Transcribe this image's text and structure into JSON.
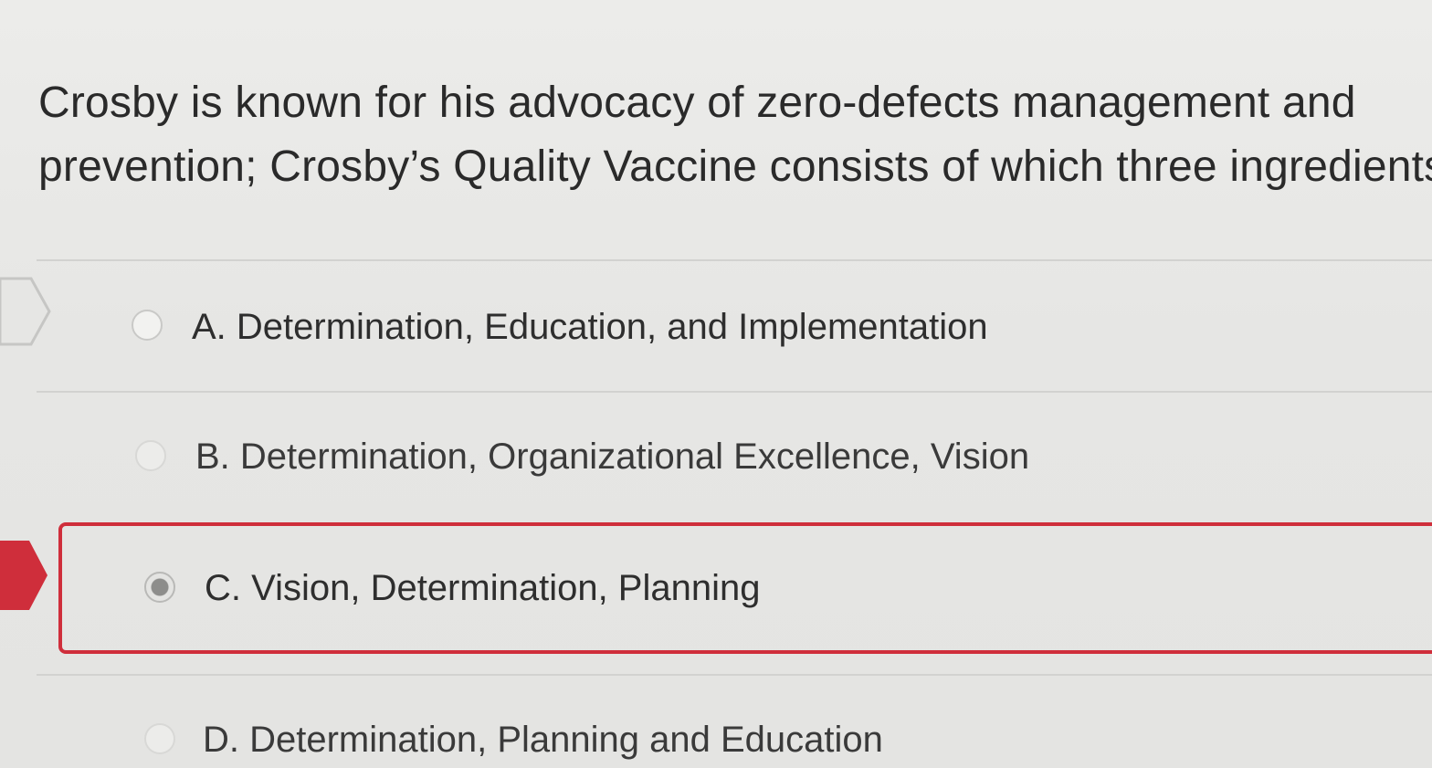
{
  "question": {
    "text": "Crosby is known for his advocacy of zero-defects management and\nprevention; Crosby’s Quality Vaccine consists of which three ingredients"
  },
  "options": [
    {
      "label": "A. Determination, Education, and Implementation",
      "selected": false
    },
    {
      "label": "B. Determination, Organizational Excellence, Vision",
      "selected": false
    },
    {
      "label": "C. Vision, Determination, Planning",
      "selected": true
    },
    {
      "label": "D. Determination, Planning and Education",
      "selected": false
    }
  ],
  "colors": {
    "selected_accent": "#cf2e3b",
    "background": "#e8e8e6",
    "text": "#2b2b2b"
  },
  "icons": {
    "pointer_outline": "chevron-arrow-outline-icon",
    "pointer_selected": "chevron-arrow-filled-icon",
    "radio": "radio-icon"
  }
}
